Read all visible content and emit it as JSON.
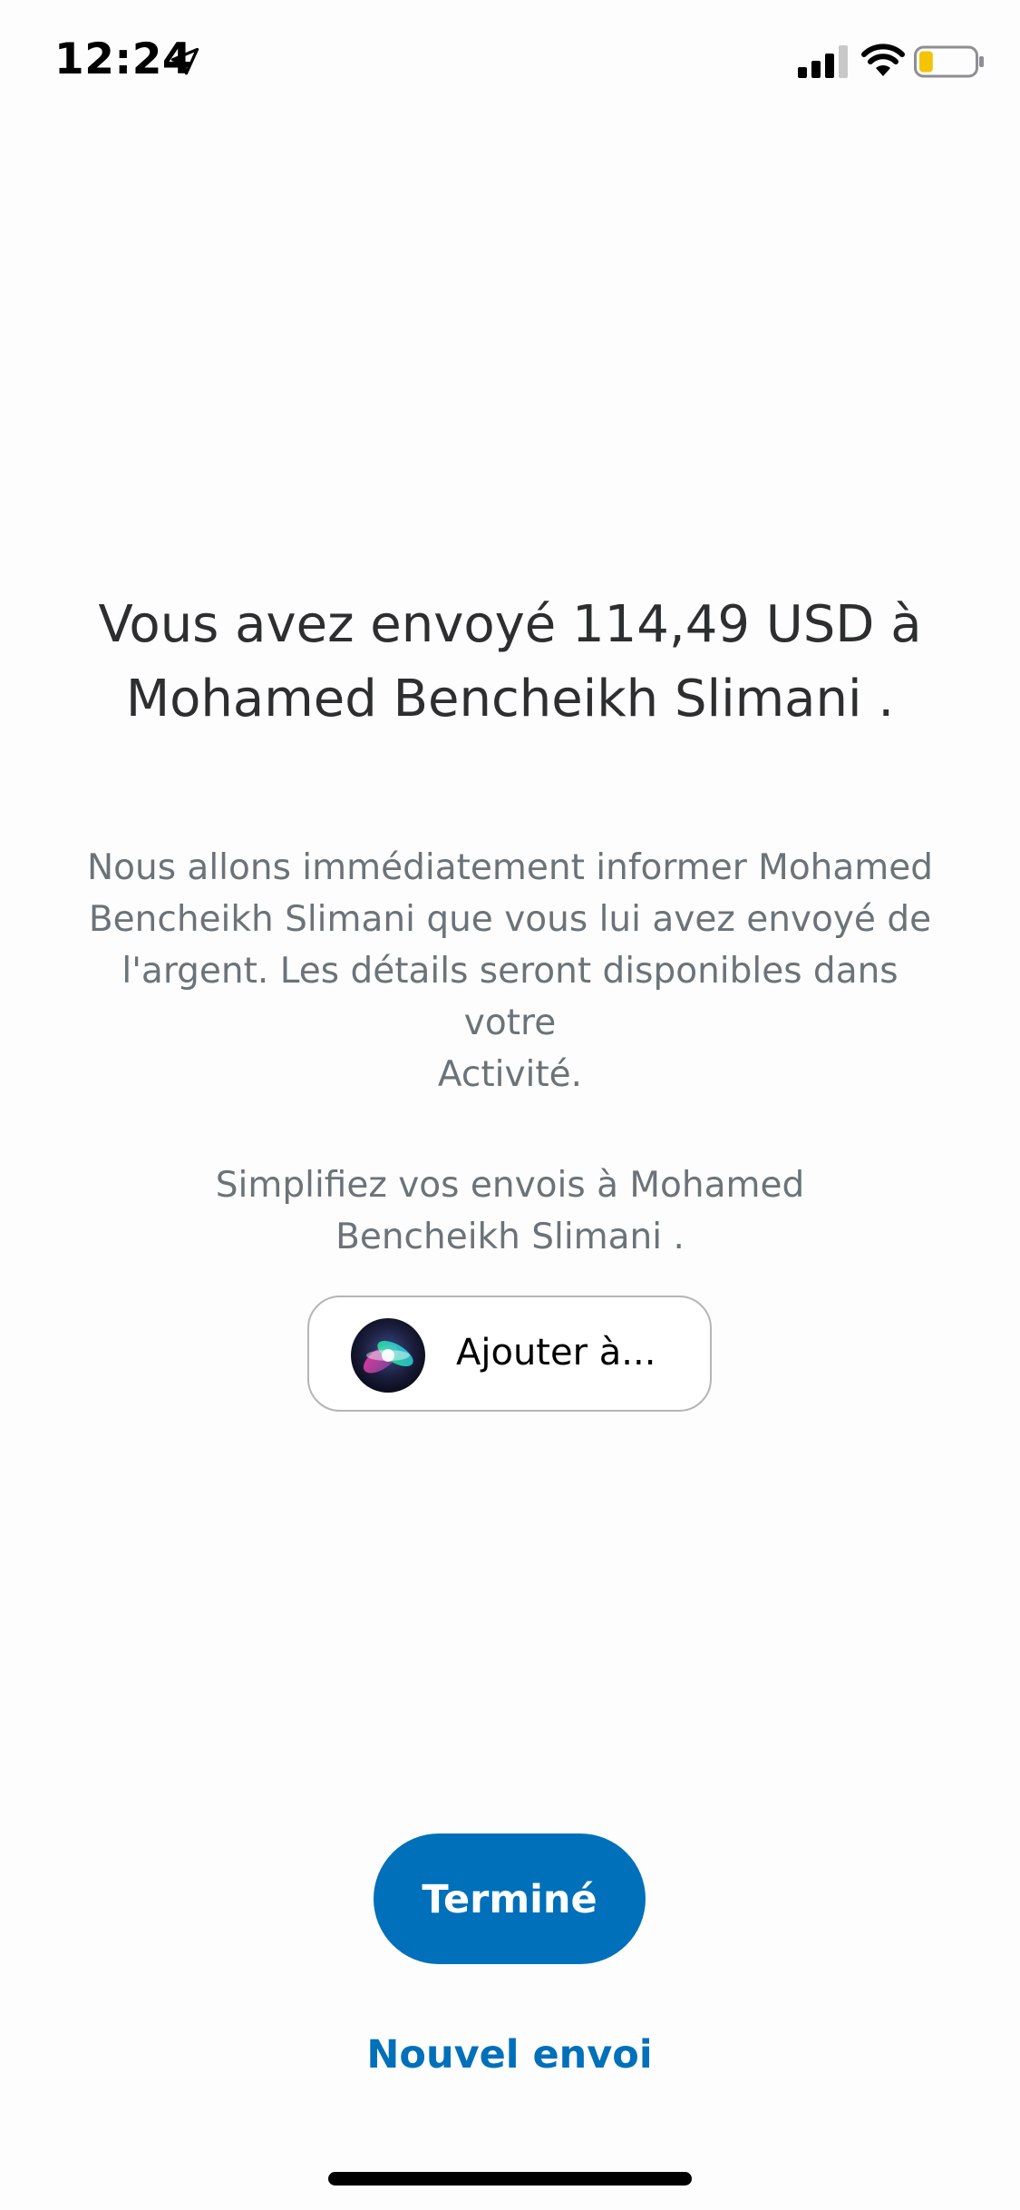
{
  "status_bar": {
    "time": "12:24",
    "location_icon": "location-arrow-icon",
    "signal_icon": "cellular-signal-icon",
    "wifi_icon": "wifi-icon",
    "battery_icon": "battery-low-icon",
    "battery_level": 0.25,
    "battery_color": "#f5c400"
  },
  "confirmation": {
    "headline_line1": "Vous avez envoyé 114,49 USD à",
    "headline_line2": "Mohamed Bencheikh  Slimani ."
  },
  "info": {
    "line1": "Nous allons immédiatement informer Mohamed",
    "line2": "Bencheikh  Slimani  que vous lui avez envoyé de",
    "line3": "l'argent. Les détails seront disponibles dans votre",
    "line4": "Activité."
  },
  "shortcut": {
    "prompt_line1": "Simplifiez vos envois à Mohamed",
    "prompt_line2": "Bencheikh  Slimani .",
    "button_label": "Ajouter à...",
    "button_icon": "siri-icon"
  },
  "actions": {
    "done_label": "Terminé",
    "new_send_label": "Nouvel envoi"
  },
  "colors": {
    "accent": "#0070ba",
    "headline_text": "#2c2e2f",
    "secondary_text": "#6c7378",
    "background": "#fdfdfd"
  }
}
